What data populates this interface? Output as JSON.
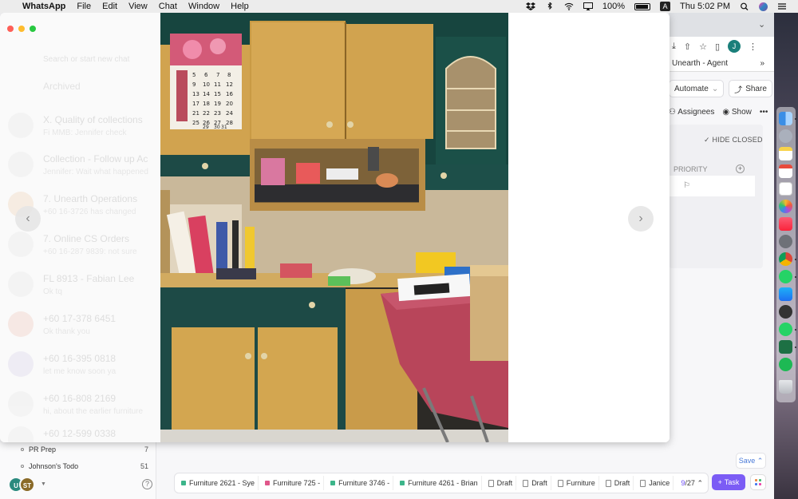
{
  "menubar": {
    "app_name": "WhatsApp",
    "menus": [
      "File",
      "Edit",
      "View",
      "Chat",
      "Window",
      "Help"
    ],
    "battery_percent": "100%",
    "clock": "Thu 5:02 PM"
  },
  "browser": {
    "bookmark_title": "Unearth - Agent",
    "bookmark_more": "»",
    "avatar_initial": "J",
    "automate_label": "Automate",
    "share_label": "Share",
    "assignees_label": "Assignees",
    "show_label": "Show",
    "more_label": "•••",
    "hide_closed_label": "HIDE CLOSED",
    "priority_label": "PRIORITY"
  },
  "clickup_sidebar": {
    "items": [
      {
        "label": "PR Prep",
        "count": "7"
      },
      {
        "label": "Johnson's Todo",
        "count": "51"
      }
    ],
    "avatars": [
      "U",
      "ST"
    ]
  },
  "tray": {
    "items": [
      {
        "label": "Furniture 2621 - Sye",
        "kind": "task",
        "color": "#3cb58a"
      },
      {
        "label": "Furniture 725 -",
        "kind": "task",
        "color": "#e0578a"
      },
      {
        "label": "Furniture 3746 -",
        "kind": "task",
        "color": "#3cb58a"
      },
      {
        "label": "Furniture 4261 - Brian",
        "kind": "task",
        "color": "#3cb58a"
      },
      {
        "label": "Draft",
        "kind": "doc"
      },
      {
        "label": "Draft",
        "kind": "doc"
      },
      {
        "label": "Furniture",
        "kind": "doc"
      },
      {
        "label": "Draft",
        "kind": "doc"
      },
      {
        "label": "Janice",
        "kind": "doc"
      }
    ],
    "page_current": "9",
    "page_total": "/27",
    "task_button": "Task",
    "save_label": "Save"
  },
  "whatsapp": {
    "search_placeholder": "Search or start new chat",
    "archived_label": "Archived",
    "chats": [
      {
        "title": "X. Quality of collections",
        "preview": "Fi MMB: Jennifer check"
      },
      {
        "title": "Collection - Follow up Ac",
        "preview": "Jennifer: Wait what happened"
      },
      {
        "title": "7. Unearth Operations",
        "preview": "+60 16-3726 has changed"
      },
      {
        "title": "7. Online CS Orders",
        "preview": "+60 16-287 9839: not sure"
      },
      {
        "title": "FL 8913 - Fabian Lee",
        "preview": "Ok tq"
      },
      {
        "title": "+60 17-378 6451",
        "preview": "Ok thank you"
      },
      {
        "title": "+60 16-395 0818",
        "preview": "let me know soon ya"
      },
      {
        "title": "+60 16-808 2169",
        "preview": "hi, about the earlier furniture"
      },
      {
        "title": "+60 12-599 0338",
        "preview": ""
      }
    ]
  },
  "calendar": {
    "numbers": [
      "5",
      "6",
      "7",
      "8",
      "9",
      "10",
      "11",
      "12",
      "13",
      "14",
      "15",
      "16",
      "17",
      "18",
      "19",
      "20",
      "21",
      "22",
      "23",
      "24",
      "25",
      "26",
      "27",
      "28",
      "29",
      "30",
      "31"
    ]
  },
  "colors": {
    "accent": "#7b5cf5",
    "whatsapp_green": "#25d366"
  }
}
